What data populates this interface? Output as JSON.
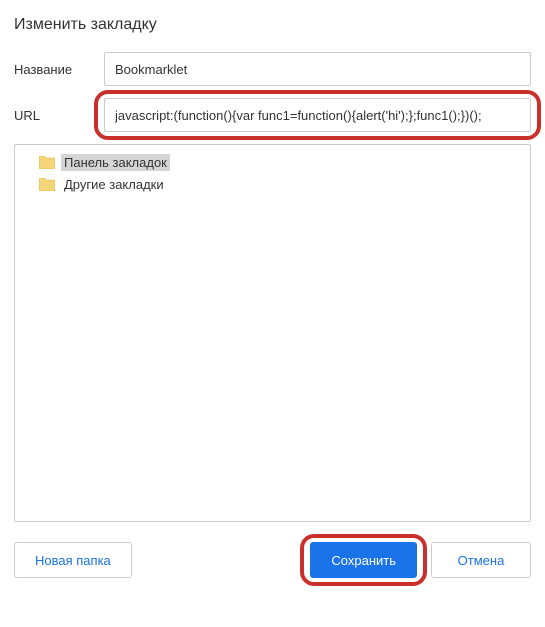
{
  "dialog": {
    "title": "Изменить закладку"
  },
  "form": {
    "name_label": "Название",
    "name_value": "Bookmarklet",
    "url_label": "URL",
    "url_value": "javascript:(function(){var func1=function(){alert('hi');};func1();})();"
  },
  "folders": {
    "items": [
      {
        "label": "Панель закладок",
        "selected": true
      },
      {
        "label": "Другие закладки",
        "selected": false
      }
    ]
  },
  "buttons": {
    "new_folder": "Новая папка",
    "save": "Сохранить",
    "cancel": "Отмена"
  }
}
